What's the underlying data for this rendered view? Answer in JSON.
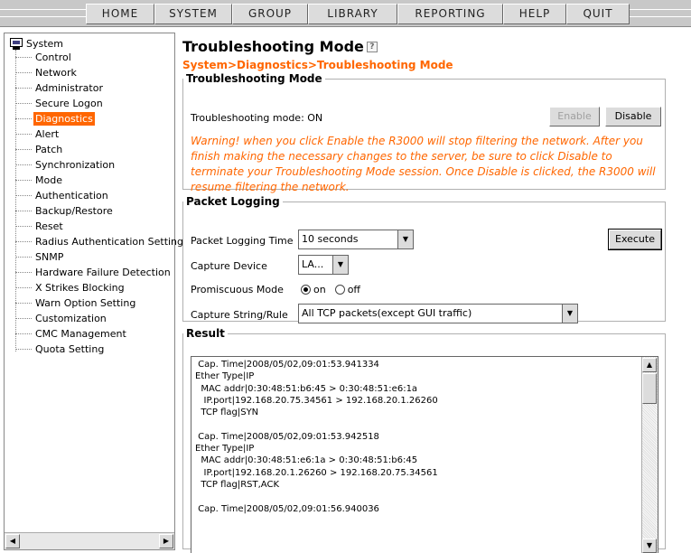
{
  "nav": {
    "items": [
      {
        "label": "HOME"
      },
      {
        "label": "SYSTEM"
      },
      {
        "label": "GROUP"
      },
      {
        "label": "LIBRARY"
      },
      {
        "label": "REPORTING"
      },
      {
        "label": "HELP"
      },
      {
        "label": "QUIT"
      }
    ]
  },
  "sidebar": {
    "root_label": "System",
    "items": [
      {
        "label": "Control"
      },
      {
        "label": "Network"
      },
      {
        "label": "Administrator"
      },
      {
        "label": "Secure Logon"
      },
      {
        "label": "Diagnostics",
        "selected": true
      },
      {
        "label": "Alert"
      },
      {
        "label": "Patch"
      },
      {
        "label": "Synchronization"
      },
      {
        "label": "Mode"
      },
      {
        "label": "Authentication"
      },
      {
        "label": "Backup/Restore"
      },
      {
        "label": "Reset"
      },
      {
        "label": "Radius Authentication Setting"
      },
      {
        "label": "SNMP"
      },
      {
        "label": "Hardware Failure Detection"
      },
      {
        "label": "X Strikes Blocking"
      },
      {
        "label": "Warn Option Setting"
      },
      {
        "label": "Customization"
      },
      {
        "label": "CMC Management"
      },
      {
        "label": "Quota Setting"
      }
    ],
    "selected_color": "#ff6600"
  },
  "main": {
    "title": "Troubleshooting Mode",
    "help_icon": "?",
    "breadcrumb": "System>Diagnostics>Troubleshooting Mode",
    "accent_color": "#ff6600",
    "troubleshooting": {
      "legend": "Troubleshooting Mode",
      "status": "Troubleshooting mode: ON",
      "enable_label": "Enable",
      "enable_disabled": true,
      "disable_label": "Disable",
      "warning": "Warning! when you click Enable the R3000 will stop filtering the network. After you finish making the necessary changes to the server, be sure to click Disable to terminate your Troubleshooting Mode session. Once Disable is clicked, the R3000 will resume filtering the network."
    },
    "packet_logging": {
      "legend": "Packet Logging",
      "time_label": "Packet Logging Time",
      "time_value": "10 seconds",
      "execute_label": "Execute",
      "device_label": "Capture Device",
      "device_value": "LA...",
      "promiscuous_label": "Promiscuous Mode",
      "promiscuous_on": "on",
      "promiscuous_off": "off",
      "promiscuous_selected": "on",
      "capture_label": "Capture String/Rule",
      "capture_value": "All TCP packets(except GUI traffic)"
    },
    "result": {
      "legend": "Result",
      "lines": [
        " Cap. Time|2008/05/02,09:01:53.941334",
        "Ether Type|IP",
        "  MAC addr|0:30:48:51:b6:45 > 0:30:48:51:e6:1a",
        "   IP.port|192.168.20.75.34561 > 192.168.20.1.26260",
        "  TCP flag|SYN",
        "",
        " Cap. Time|2008/05/02,09:01:53.942518",
        "Ether Type|IP",
        "  MAC addr|0:30:48:51:e6:1a > 0:30:48:51:b6:45",
        "   IP.port|192.168.20.1.26260 > 192.168.20.75.34561",
        "  TCP flag|RST,ACK",
        "",
        " Cap. Time|2008/05/02,09:01:56.940036"
      ]
    }
  }
}
